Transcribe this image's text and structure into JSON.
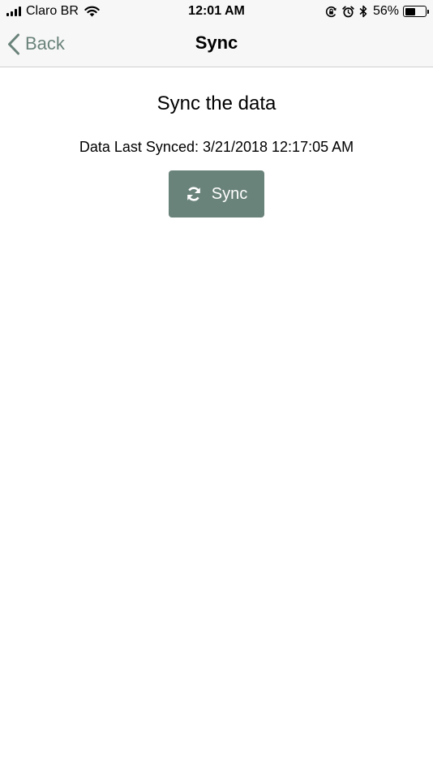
{
  "status_bar": {
    "carrier": "Claro BR",
    "time": "12:01 AM",
    "battery_percent": "56%",
    "battery_level": 0.56
  },
  "nav": {
    "back_label": "Back",
    "title": "Sync"
  },
  "content": {
    "heading": "Sync the data",
    "last_synced": "Data Last Synced: 3/21/2018 12:17:05 AM",
    "sync_button_label": "Sync"
  },
  "colors": {
    "accent": "#6a837a",
    "bar_background": "#f7f7f7"
  },
  "icons": {
    "back": "chevron-left-icon",
    "sync": "refresh-icon",
    "wifi": "wifi-icon",
    "orientation_lock": "orientation-lock-icon",
    "alarm": "alarm-icon",
    "bluetooth": "bluetooth-icon"
  }
}
